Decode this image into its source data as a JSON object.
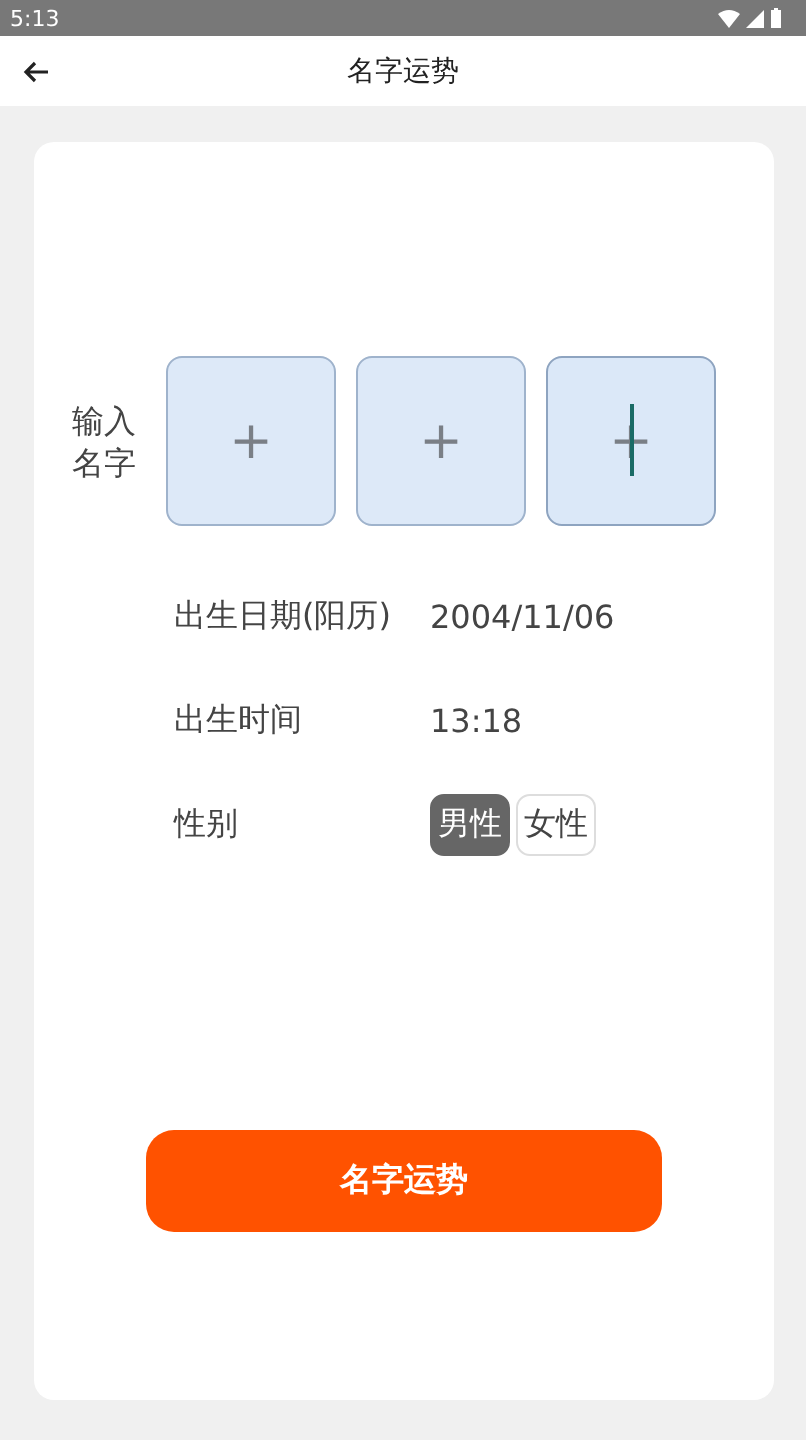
{
  "status_bar": {
    "time": "5:13"
  },
  "app_bar": {
    "title": "名字运势"
  },
  "name_input": {
    "label": "输入名字",
    "boxes": [
      {
        "placeholder": "+",
        "focused": false
      },
      {
        "placeholder": "+",
        "focused": false
      },
      {
        "placeholder": "+",
        "focused": true
      }
    ]
  },
  "fields": [
    {
      "label": "出生日期(阳历)",
      "value": "2004/11/06"
    },
    {
      "label": "出生时间",
      "value": "13:18"
    }
  ],
  "gender": {
    "label": "性别",
    "options": [
      {
        "label": "男性",
        "selected": true
      },
      {
        "label": "女性",
        "selected": false
      }
    ]
  },
  "submit_button": "名字运势"
}
